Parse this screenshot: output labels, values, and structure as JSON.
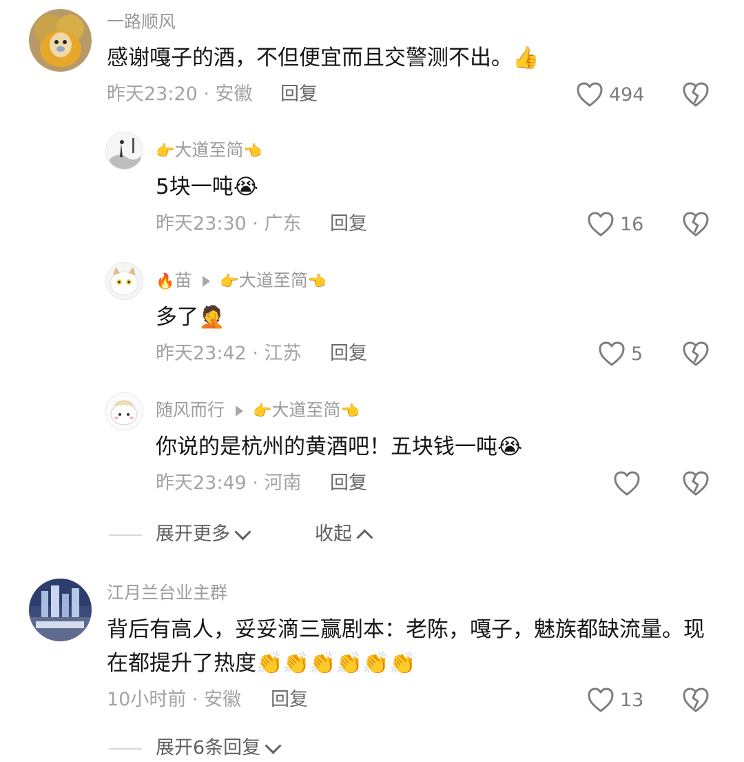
{
  "comments": [
    {
      "username": "一路顺风",
      "text": "感谢嘎子的酒，不但便宜而且交警测不出。",
      "emoji": "👍",
      "time_location": "昨天23:20 · 安徽",
      "reply_label": "回复",
      "likes": "494",
      "replies": [
        {
          "username": "大道至简",
          "name_prefix_emoji": "👉",
          "name_suffix_emoji": "👈",
          "text": "5块一吨",
          "emoji": "😭",
          "time_location": "昨天23:30 · 广东",
          "reply_label": "回复",
          "likes": "16"
        },
        {
          "username": "苗",
          "name_prefix_emoji": "🔥",
          "reply_to": "大道至简",
          "reply_to_prefix_emoji": "👉",
          "reply_to_suffix_emoji": "👈",
          "text": "多了",
          "emoji": "🤦",
          "time_location": "昨天23:42 · 江苏",
          "reply_label": "回复",
          "likes": "5"
        },
        {
          "username": "随风而行",
          "reply_to": "大道至简",
          "reply_to_prefix_emoji": "👉",
          "reply_to_suffix_emoji": "👈",
          "text": "你说的是杭州的黄酒吧！五块钱一吨",
          "emoji": "😭",
          "time_location": "昨天23:49 · 河南",
          "reply_label": "回复",
          "likes": ""
        }
      ],
      "expand_more_label": "展开更多",
      "collapse_label": "收起"
    },
    {
      "username": "江月兰台业主群",
      "text_line1": "背后有高人，妥妥滴三赢剧本：老陈，嘎子，魅族都缺流量。现",
      "text_line2": "在都提升了热度",
      "emoji": "👏👏👏👏👏👏",
      "time_location": "10小时前 · 安徽",
      "reply_label": "回复",
      "likes": "13",
      "expand_replies_label": "展开6条回复"
    }
  ],
  "colors": {
    "username": "#9b9b9b",
    "meta": "#a3a3a3",
    "body_text": "#161616",
    "icon": "#7d7d7d"
  },
  "icons": {
    "like": "heart-outline-icon",
    "dislike": "broken-heart-outline-icon",
    "expand": "chevron-down-icon",
    "collapse": "chevron-up-icon",
    "reply_arrow": "triangle-right-icon"
  }
}
